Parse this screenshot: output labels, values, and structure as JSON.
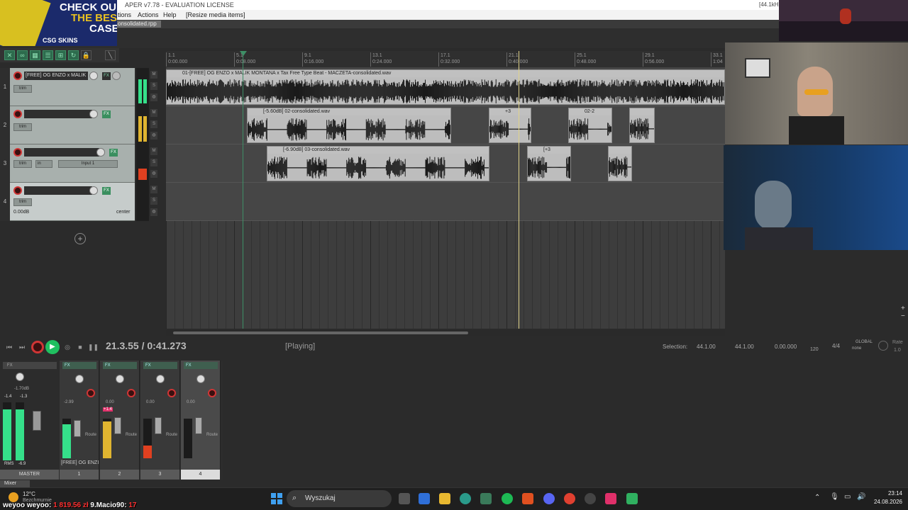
{
  "window": {
    "title": "APER v7.78 - EVALUATION LICENSE",
    "sample_rate": "[44.1kHz"
  },
  "menu": {
    "items": [
      {
        "label": "tions"
      },
      {
        "label": "Actions"
      },
      {
        "label": "Help"
      },
      {
        "label": "[Resize media items]"
      }
    ]
  },
  "project_tab": {
    "label": "onsolidated.rpp"
  },
  "ruler": {
    "marks": [
      {
        "bar": "1.1",
        "time": "0:00.000"
      },
      {
        "bar": "5.1",
        "time": "0:08.000"
      },
      {
        "bar": "9.1",
        "time": "0:16.000"
      },
      {
        "bar": "13.1",
        "time": "0:24.000"
      },
      {
        "bar": "17.1",
        "time": "0:32.000"
      },
      {
        "bar": "21.1",
        "time": "0:40.000"
      },
      {
        "bar": "25.1",
        "time": "0:48.000"
      },
      {
        "bar": "29.1",
        "time": "0:56.000"
      },
      {
        "bar": "33.1",
        "time": "1:04"
      }
    ]
  },
  "tracks": [
    {
      "num": "1",
      "name": "[FREE] OG ENZO x MALIK",
      "trim": "trim",
      "fx": "FX"
    },
    {
      "num": "2",
      "name": "",
      "trim": "trim",
      "fx": "FX"
    },
    {
      "num": "3",
      "name": "",
      "trim": "trim",
      "fx": "FX",
      "input": "Input 1",
      "in": "in"
    },
    {
      "num": "4",
      "name": "",
      "trim": "trim",
      "fx": "FX",
      "volume": "0.00dB",
      "pan": "center"
    }
  ],
  "items": [
    {
      "label": "01-[FREE] OG ENZO x MALIK MONTANA x Tax Free Type Beat - MACZETA-consolidated.wav"
    },
    {
      "label": "[-5.60dB] 02-consolidated.wav"
    },
    {
      "label": "+3"
    },
    {
      "label": "02-2"
    },
    {
      "label": "[-6.90dB] 03-consolidated.wav"
    },
    {
      "label": "[+3"
    }
  ],
  "transport": {
    "position": "21.3.55 / 0:41.273",
    "state": "[Playing]",
    "selection_label": "Selection:",
    "selection_start": "44.1.00",
    "selection_end": "44.1.00",
    "selection_len": "0.00.000",
    "bpm": "120",
    "timesig": "4/4",
    "global_label": "GLOBAL",
    "global_value": "none",
    "rate_label": "Rate",
    "rate_value": "1.0"
  },
  "mixer": {
    "master": {
      "label": "MASTER",
      "vol": "-1.70dB",
      "peak_l": "-1.4",
      "peak_r": "-1.3",
      "rms_label": "RMS",
      "rms_value": "-6.9"
    },
    "strips": [
      {
        "label": "1",
        "vol": "-2.99",
        "name": "[FREE] OG ENZI",
        "route": "Route"
      },
      {
        "label": "2",
        "vol": "0.00",
        "peak": "+1.4",
        "route": "Route"
      },
      {
        "label": "3",
        "vol": "0.00",
        "route": "Route"
      },
      {
        "label": "4",
        "vol": "0.00",
        "route": "Route"
      }
    ],
    "tab": "Mixer"
  },
  "overlays": {
    "banner_line1": "CHECK OU",
    "banner_line2": "THE BES",
    "banner_line3": "CASE",
    "banner_brand": "CSG SKINS"
  },
  "taskbar": {
    "search_placeholder": "Wyszukaj",
    "weather_temp": "12°C",
    "weather_desc": "Bezchmurnie",
    "time": "23:14",
    "date": "24.08.2026",
    "ticker": [
      {
        "name": "weyoo weyoo:",
        "value": "1 819.56 zł"
      },
      {
        "name": "9.Macio90:",
        "value": "17"
      }
    ]
  },
  "colors": {
    "accent_green": "#2d6b4d",
    "record_red": "#d03535",
    "play_green": "#20c060",
    "ticker_red": "#ff3030"
  }
}
